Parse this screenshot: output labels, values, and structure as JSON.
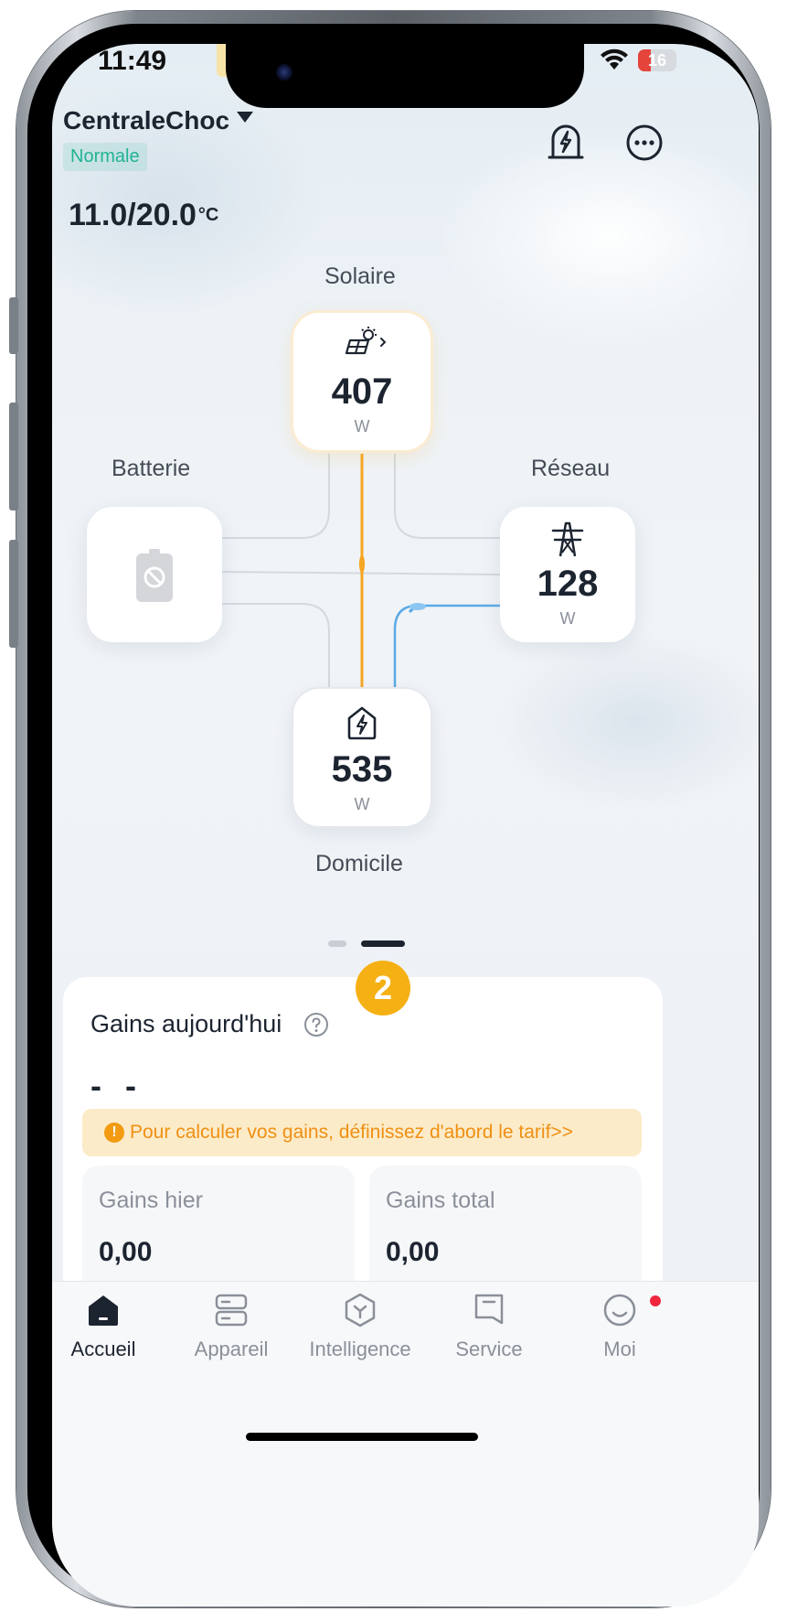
{
  "status_bar": {
    "time": "11:49",
    "battery": "16"
  },
  "header": {
    "plant_name": "CentraleChoc",
    "status": "Normale",
    "temperature": "11.0/20.0",
    "temperature_unit": "°C",
    "icons": [
      "power-station-icon",
      "more-icon"
    ]
  },
  "energy_flow": {
    "solar": {
      "label": "Solaire",
      "value": "407",
      "unit": "W",
      "icon": "solar-panel-icon"
    },
    "battery": {
      "label": "Batterie",
      "icon": "battery-disabled-icon"
    },
    "grid": {
      "label": "Réseau",
      "value": "128",
      "unit": "W",
      "icon": "power-tower-icon"
    },
    "home": {
      "label": "Domicile",
      "value": "535",
      "unit": "W",
      "icon": "home-power-icon"
    },
    "colors": {
      "solar_flow": "#f5a623",
      "grid_flow": "#5aa9e6"
    }
  },
  "pagination": {
    "active_page": 2,
    "pages": 2
  },
  "step_badge": "2",
  "earnings": {
    "title": "Gains aujourd'hui",
    "today_value": "- -",
    "tariff_notice": "Pour calculer vos gains, définissez d'abord le tarif>>",
    "yesterday_label": "Gains hier",
    "yesterday_value": "0,00",
    "total_label": "Gains total",
    "total_value": "0,00"
  },
  "tabs": [
    {
      "label": "Accueil",
      "icon": "home-icon",
      "active": true
    },
    {
      "label": "Appareil",
      "icon": "device-icon",
      "active": false
    },
    {
      "label": "Intelligence",
      "icon": "intelligence-icon",
      "active": false
    },
    {
      "label": "Service",
      "icon": "service-icon",
      "active": false
    },
    {
      "label": "Moi",
      "icon": "profile-icon",
      "active": false,
      "notification": true
    }
  ]
}
